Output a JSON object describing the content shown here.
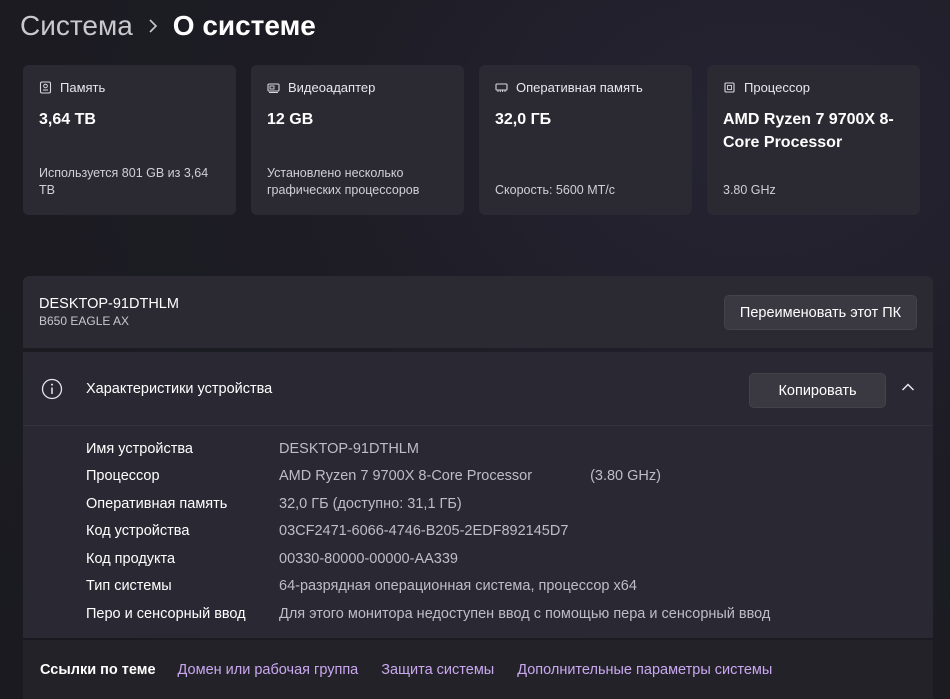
{
  "breadcrumb": {
    "parent": "Система",
    "separator_icon": "chevron-right-icon",
    "current": "О системе"
  },
  "cards": [
    {
      "icon": "storage-icon",
      "title": "Память",
      "value": "3,64 TB",
      "sub": "Используется 801 GB из 3,64 TB"
    },
    {
      "icon": "gpu-icon",
      "title": "Видеоадаптер",
      "value": "12 GB",
      "sub": "Установлено несколько графических процессоров"
    },
    {
      "icon": "ram-icon",
      "title": "Оперативная память",
      "value": "32,0 ГБ",
      "sub": "Скорость: 5600 МТ/с"
    },
    {
      "icon": "cpu-icon",
      "title": "Процессор",
      "value": "AMD Ryzen 7 9700X 8-Core Processor",
      "sub": "3.80 GHz"
    }
  ],
  "device": {
    "name": "DESKTOP-91DTHLM",
    "model": "B650 EAGLE AX",
    "rename_button": "Переименовать этот ПК"
  },
  "spec": {
    "title": "Характеристики устройства",
    "copy_button": "Копировать",
    "rows": [
      {
        "label": "Имя устройства",
        "value": "DESKTOP-91DTHLM"
      },
      {
        "label": "Процессор",
        "value": "AMD Ryzen 7 9700X 8-Core Processor",
        "extra": "(3.80 GHz)"
      },
      {
        "label": "Оперативная память",
        "value": "32,0 ГБ (доступно: 31,1 ГБ)"
      },
      {
        "label": "Код устройства",
        "value": "03CF2471-6066-4746-B205-2EDF892145D7"
      },
      {
        "label": "Код продукта",
        "value": "00330-80000-00000-AA339"
      },
      {
        "label": "Тип системы",
        "value": "64-разрядная операционная система, процессор x64"
      },
      {
        "label": "Перо и сенсорный ввод",
        "value": "Для этого монитора недоступен ввод с помощью пера и сенсорный ввод"
      }
    ]
  },
  "related": {
    "title": "Ссылки по теме",
    "links": [
      "Домен или рабочая группа",
      "Защита системы",
      "Дополнительные параметры системы"
    ]
  },
  "colors": {
    "background": "#1c1b22",
    "card": "#2b2a33",
    "link": "#c9a8f0"
  }
}
